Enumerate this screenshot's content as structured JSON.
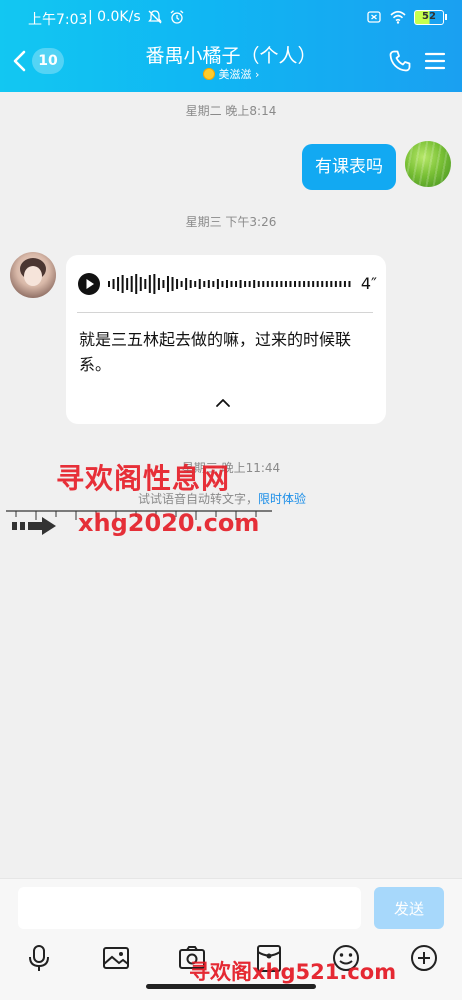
{
  "status_bar": {
    "time": "上午7:03",
    "network_speed": "| 0.0K/s",
    "battery": "52"
  },
  "header": {
    "back_count": "10",
    "title": "番禺小橘子（个人）",
    "subtitle": "美滋滋 ›"
  },
  "messages": {
    "ts1": "星期二 晚上8:14",
    "sent_text": "有课表吗",
    "ts2": "星期三 下午3:26",
    "voice_duration": "4″",
    "voice_transcript": "就是三五林起去做的嘛，过来的时候联系。",
    "ts3": "星期三 晚上11:44"
  },
  "hint": {
    "text": "试试语音自动转文字，",
    "link": "限时体验"
  },
  "watermarks": {
    "w1": "寻欢阁性息网",
    "w2": "xhg2020.com",
    "w3": "寻欢阁xhg521.com"
  },
  "input": {
    "placeholder": "",
    "send_label": "发送"
  },
  "icons": {
    "toolbar": [
      "microphone-icon",
      "image-icon",
      "camera-icon",
      "red-packet-icon",
      "emoji-icon",
      "plus-icon"
    ]
  },
  "colors": {
    "header_start": "#12c7f2",
    "header_end": "#1aa0f1",
    "sent_bubble": "#12a9f2",
    "send_button": "#a7d8fb",
    "link": "#1b8ee8",
    "watermark": "#e41e28"
  }
}
